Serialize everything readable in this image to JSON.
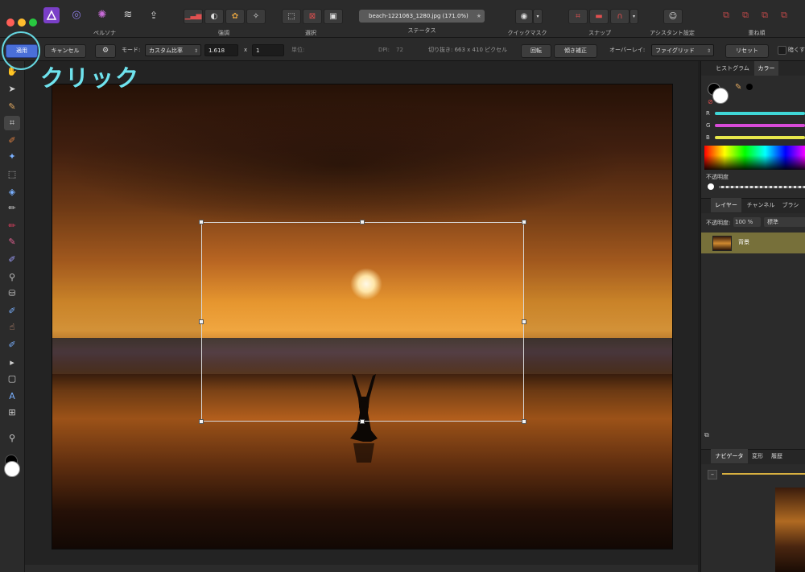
{
  "window": {
    "document_title": "beach-1221063_1280.jpg (171.0%)",
    "title_star": "★"
  },
  "personas": {
    "label": "ペルソナ"
  },
  "toolbar_groups": [
    {
      "label": "強調"
    },
    {
      "label": "選択"
    },
    {
      "label": "ステータス"
    },
    {
      "label": "クイックマスク"
    },
    {
      "label": "スナップ"
    },
    {
      "label": "アシスタント設定"
    },
    {
      "label": "重ね順"
    }
  ],
  "context_bar": {
    "apply_label": "適用",
    "cancel_label": "キャンセル",
    "mode_label": "モード:",
    "mode_value": "カスタム比率",
    "ratio_w": "1.618",
    "ratio_x": "x",
    "ratio_h": "1",
    "unit_label": "単位:",
    "dpi_label": "DPI:",
    "dpi_value": "72",
    "crop_info": "切り抜き: 663 x 410 ピクセル",
    "rotate_label": "回転",
    "straighten_label": "傾き補正",
    "overlay_label": "オーバーレイ:",
    "overlay_value": "ファイグリッド",
    "reset_label": "リセット",
    "darken_label": "暗くす"
  },
  "annotation": {
    "text": "クリック",
    "color": "#6fe3ee"
  },
  "color_panel": {
    "tab_histogram": "ヒストグラム",
    "tab_color": "カラー",
    "r_label": "R",
    "g_label": "G",
    "b_label": "B",
    "opacity_label": "不透明度"
  },
  "layers_panel": {
    "tab_layers": "レイヤー",
    "tab_channels": "チャンネル",
    "tab_brush": "ブラシ",
    "opacity_label": "不透明度:",
    "opacity_value": "100 %",
    "blend_value": "標準",
    "layer_name": "背景"
  },
  "navigator_panel": {
    "tab_navigator": "ナビゲータ",
    "tab_transform": "変形",
    "tab_history": "履歴"
  },
  "colors": {
    "accent_apply": "#4a6fd8",
    "annotation_ring": "#65d6e0",
    "slider_r": "#3fd6d6",
    "slider_g": "#d84bd8",
    "slider_b": "#e8e84b"
  }
}
